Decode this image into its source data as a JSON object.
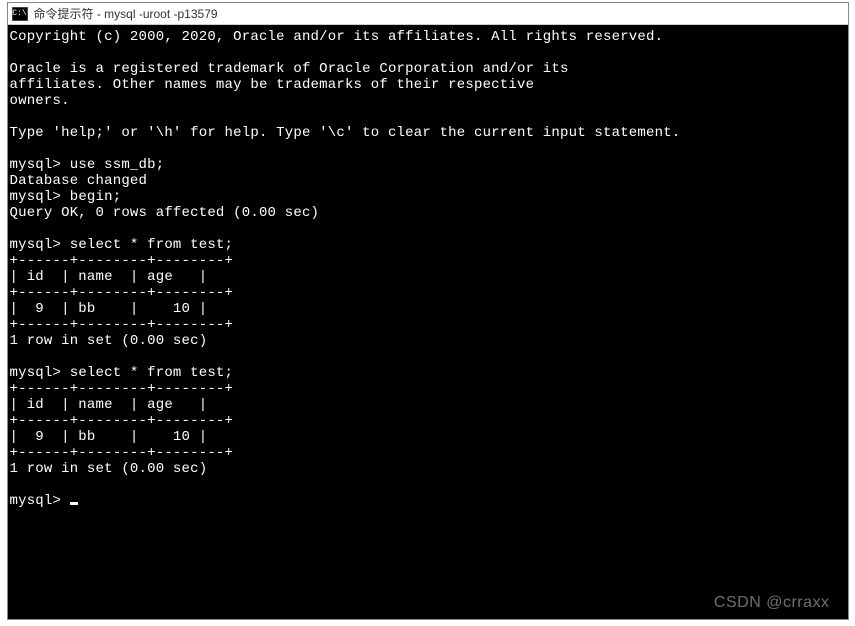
{
  "window": {
    "icon_label": "C:\\",
    "title": "命令提示符 - mysql  -uroot -p13579"
  },
  "terminal": {
    "copyright": "Copyright (c) 2000, 2020, Oracle and/or its affiliates. All rights reserved.",
    "trademark_line1": "Oracle is a registered trademark of Oracle Corporation and/or its",
    "trademark_line2": "affiliates. Other names may be trademarks of their respective",
    "trademark_line3": "owners.",
    "help_hint": "Type 'help;' or '\\h' for help. Type '\\c' to clear the current input statement.",
    "prompt": "mysql>",
    "cmd1": "use ssm_db;",
    "resp1": "Database changed",
    "cmd2": "begin;",
    "resp2": "Query OK, 0 rows affected (0.00 sec)",
    "cmd3": "select * from test;",
    "table_border": "+------+--------+--------+",
    "table_border_mid": "+------+--------+--------+",
    "table_header": "| id  | name  | age   |",
    "table_row": "|  9  | bb    |    10 |",
    "table_footer": "1 row in set (0.00 sec)",
    "cmd4": "select * from test;"
  },
  "watermark": "CSDN @crraxx"
}
